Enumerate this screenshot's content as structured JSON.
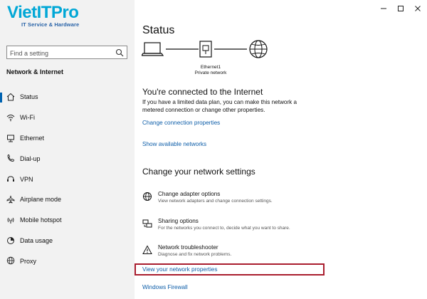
{
  "logo": {
    "name": "VietITPro",
    "tagline": "IT Service & Hardware"
  },
  "sidebar": {
    "search_placeholder": "Find a setting",
    "section_title": "Network & Internet",
    "items": [
      {
        "label": "Status",
        "icon": "home-icon",
        "active": true
      },
      {
        "label": "Wi-Fi",
        "icon": "wifi-icon"
      },
      {
        "label": "Ethernet",
        "icon": "ethernet-icon"
      },
      {
        "label": "Dial-up",
        "icon": "phone-icon"
      },
      {
        "label": "VPN",
        "icon": "vpn-icon"
      },
      {
        "label": "Airplane mode",
        "icon": "airplane-icon"
      },
      {
        "label": "Mobile hotspot",
        "icon": "hotspot-icon"
      },
      {
        "label": "Data usage",
        "icon": "data-usage-icon"
      },
      {
        "label": "Proxy",
        "icon": "globe-icon"
      }
    ]
  },
  "main": {
    "title": "Status",
    "diagram": {
      "adapter": "Ethernet1",
      "network": "Private network"
    },
    "connected_heading": "You're connected to the Internet",
    "connected_text": "If you have a limited data plan, you can make this network a metered connection or change other properties.",
    "link_change_connection": "Change connection properties",
    "link_show_networks": "Show available networks",
    "settings_heading": "Change your network settings",
    "options": [
      {
        "title": "Change adapter options",
        "desc": "View network adapters and change connection settings.",
        "icon": "globe-icon"
      },
      {
        "title": "Sharing options",
        "desc": "For the networks you connect to, decide what you want to share.",
        "icon": "sharing-icon"
      },
      {
        "title": "Network troubleshooter",
        "desc": "Diagnose and fix network problems.",
        "icon": "warning-icon"
      }
    ],
    "link_view_properties": "View your network properties",
    "link_firewall": "Windows Firewall"
  },
  "colors": {
    "accent": "#0063b1",
    "link": "#0b5ca8",
    "highlight": "#a91d2e",
    "logo": "#00a7d6"
  }
}
